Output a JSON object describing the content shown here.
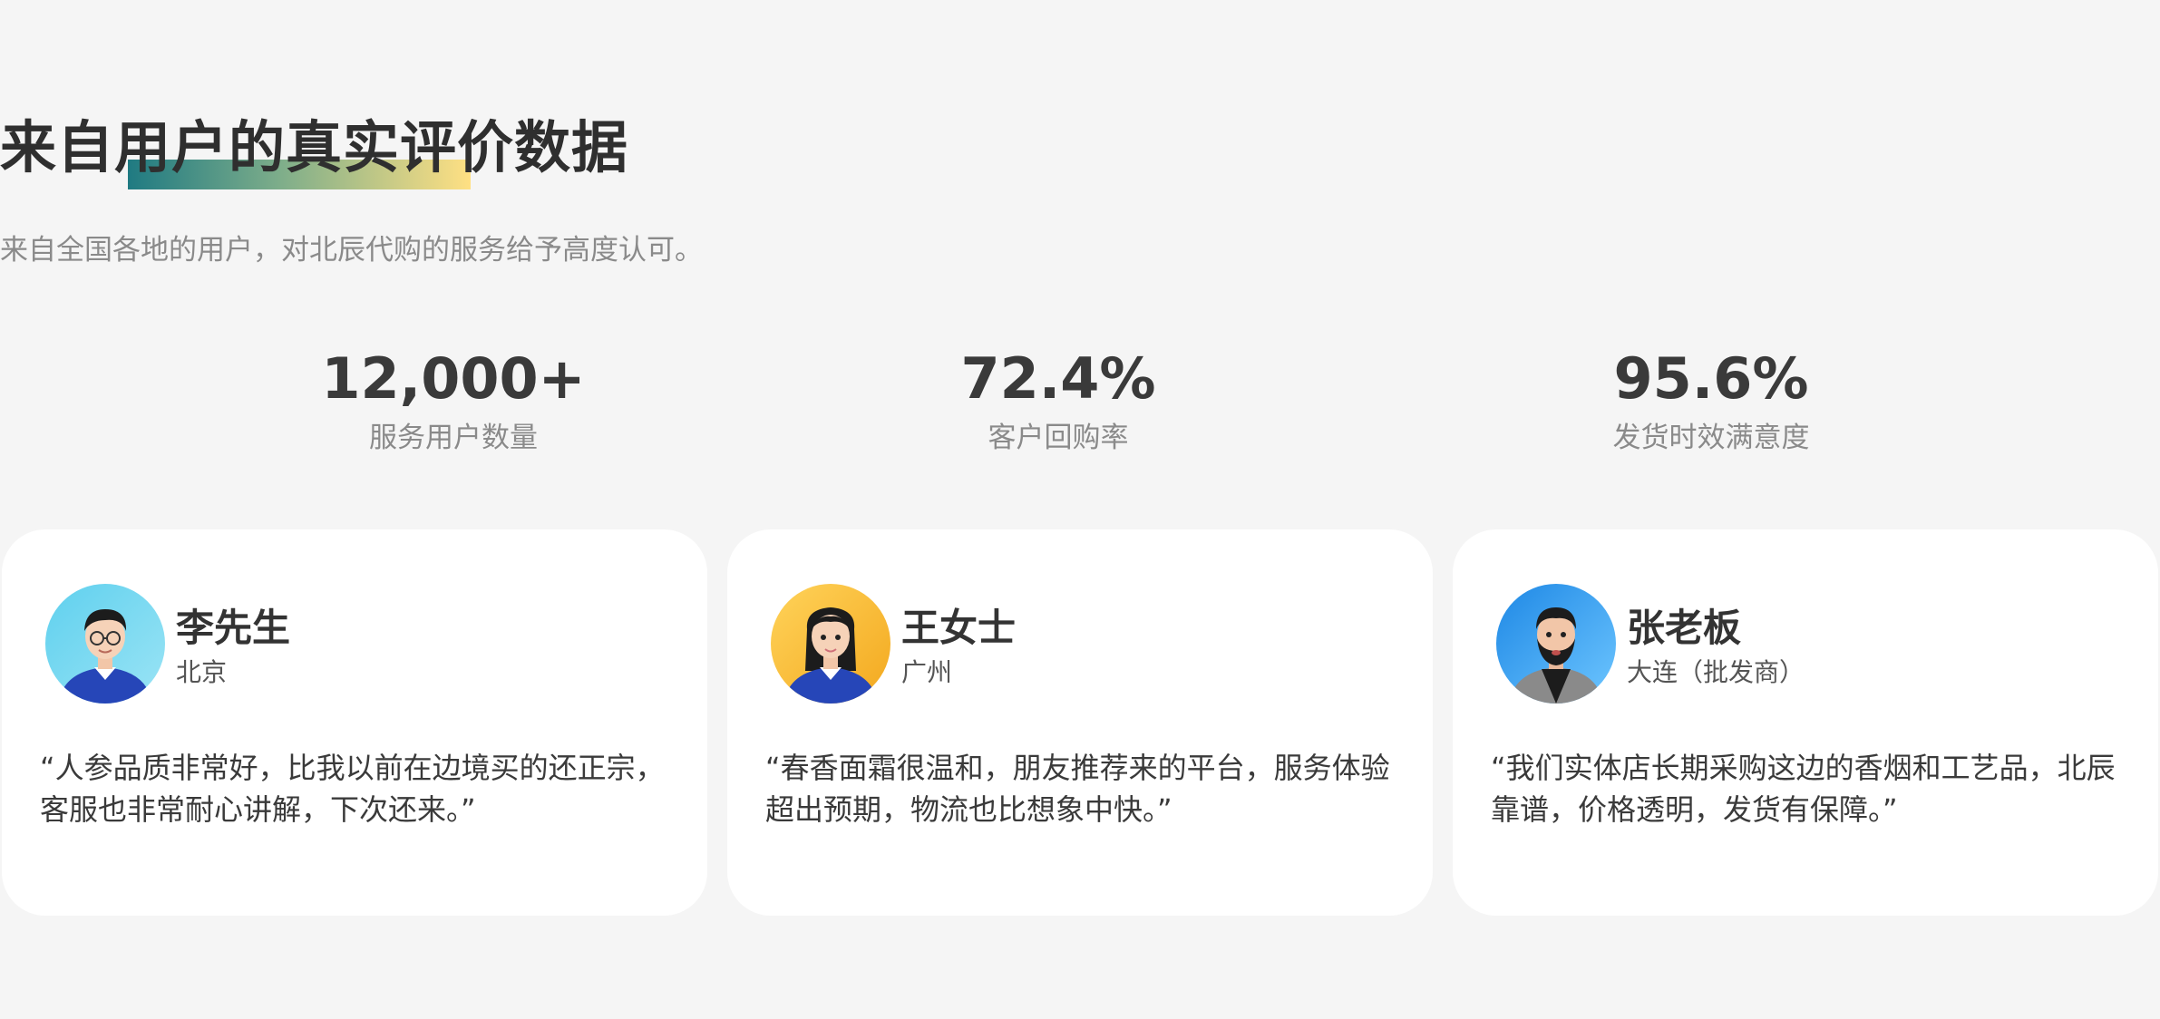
{
  "header": {
    "title": "来自用户的真实评价数据",
    "subtitle": "来自全国各地的用户，对北辰代购的服务给予高度认可。"
  },
  "stats": [
    {
      "value": "12,000+",
      "label": "服务用户数量"
    },
    {
      "value": "72.4%",
      "label": "客户回购率"
    },
    {
      "value": "95.6%",
      "label": "发货时效满意度"
    }
  ],
  "testimonials": [
    {
      "name": "李先生",
      "location": "北京",
      "avatar_icon": "male-avatar-glasses-icon",
      "review": "“人参品质非常好，比我以前在边境买的还正宗，客服也非常耐心讲解，下次还来。”"
    },
    {
      "name": "王女士",
      "location": "广州",
      "avatar_icon": "female-avatar-icon",
      "review": "“春香面霜很温和，朋友推荐来的平台，服务体验超出预期，物流也比想象中快。”"
    },
    {
      "name": "张老板",
      "location": "大连（批发商）",
      "avatar_icon": "male-avatar-beard-icon",
      "review": "“我们实体店长期采购这边的香烟和工艺品，北辰靠谱，价格透明，发货有保障。”"
    }
  ],
  "colors": {
    "background": "#f5f5f5",
    "card": "#ffffff",
    "underline_start": "#1f7a82",
    "underline_end": "#ffe083"
  }
}
